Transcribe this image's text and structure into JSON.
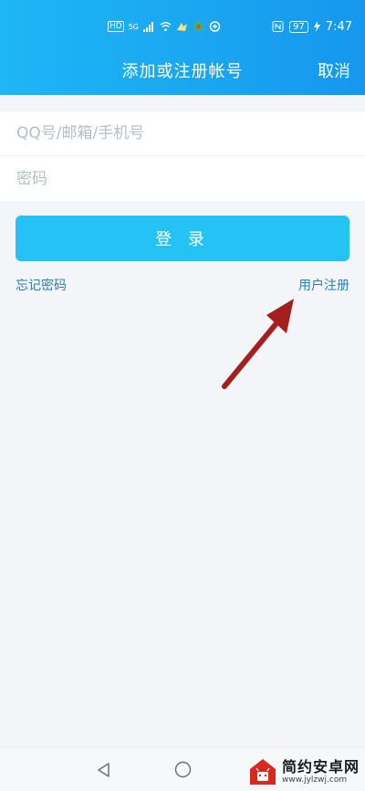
{
  "status_bar": {
    "network": "HD",
    "signal_gen": "5G",
    "battery": "97",
    "time": "7:47"
  },
  "header": {
    "title": "添加或注册帐号",
    "cancel_label": "取消"
  },
  "form": {
    "account_placeholder": "QQ号/邮箱/手机号",
    "password_placeholder": "密码"
  },
  "login_button": "登 录",
  "links": {
    "forgot_password": "忘记密码",
    "register": "用户注册"
  },
  "watermark": {
    "name": "简约安卓网",
    "url": "www.jylzwj.com"
  },
  "colors": {
    "header_start": "#1eb6f4",
    "header_end": "#1597ee",
    "button": "#25c2f5",
    "link": "#2a7fb8",
    "arrow": "#a51f1f"
  }
}
